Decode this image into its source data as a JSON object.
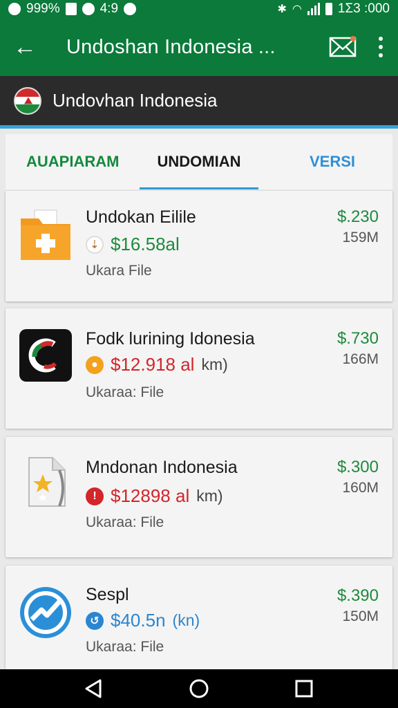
{
  "status": {
    "battery_left": "999%",
    "time": "4:9",
    "clock": "1Σ3 :000"
  },
  "appbar": {
    "title": "Undoshan Indonesia ..."
  },
  "subheader": {
    "name": "Undovhan Indonesia"
  },
  "tabs": [
    {
      "label": "AUAPIARAM",
      "color": "#13893d"
    },
    {
      "label": "UNDOMIAN",
      "active": true
    },
    {
      "label": "VERSI",
      "color": "#2f8fd6"
    }
  ],
  "items": [
    {
      "title": "Undokan Eilile",
      "price": "$16.58al",
      "unit": "",
      "price_color": "#1e8a3c",
      "sub": "Ukara File",
      "value": "$.230",
      "size": "159M",
      "icon": "folder-plus-icon"
    },
    {
      "title": "Fodk lurining Idonesia",
      "price": "$12.918 al",
      "unit": "km)",
      "price_color": "#d3252a",
      "sub": "Ukaraa: File",
      "value": "$.730",
      "size": "166M",
      "icon": "app-logo-icon"
    },
    {
      "title": "Mndonan Indonesia",
      "price": "$12898 al",
      "unit": "km)",
      "price_color": "#d3252a",
      "sub": "Ukaraa: File",
      "value": "$.300",
      "size": "160M",
      "icon": "star-file-icon"
    },
    {
      "title": "Sespl",
      "price": "$40.5n",
      "unit": "(kn)",
      "price_color": "#2a86d0",
      "sub": "Ukaraa: File",
      "value": "$.390",
      "size": "150M",
      "icon": "chart-circle-icon"
    }
  ]
}
